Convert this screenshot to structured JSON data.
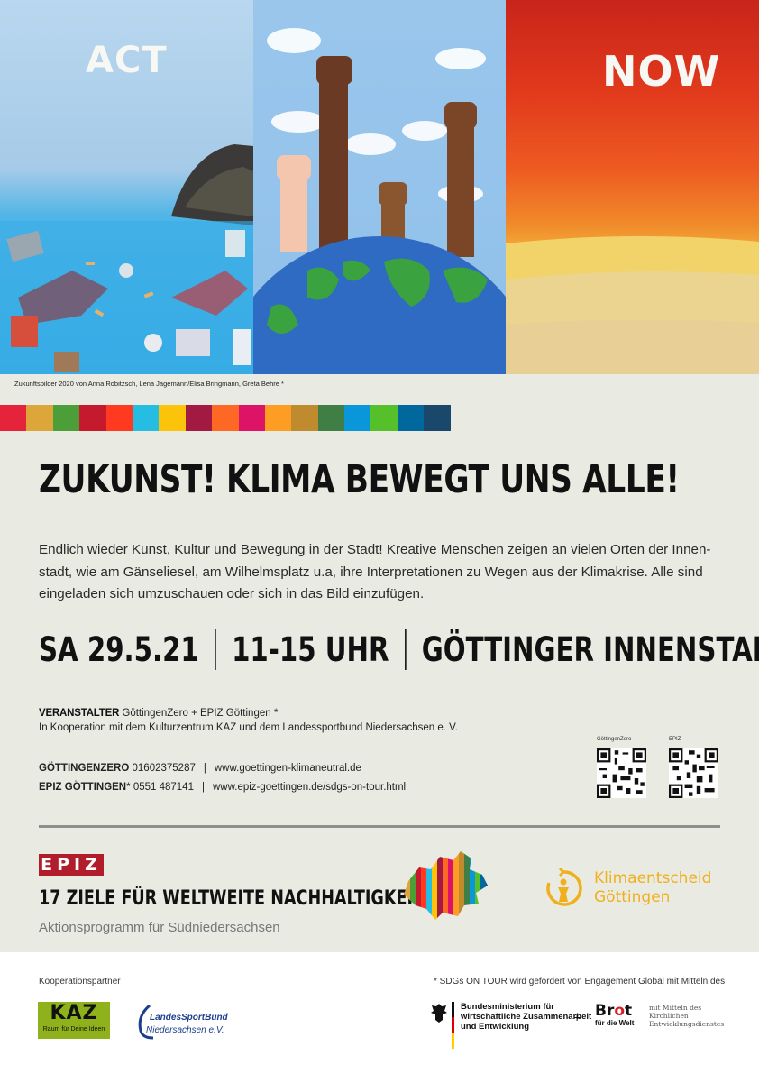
{
  "hero": {
    "word_left": "ACT",
    "word_right": "NOW",
    "caption": "Zukunftsbilder 2020 von Anna Robitzsch, Lena Jagemann/Elisa Bringmann, Greta Behre *"
  },
  "sdg_colors": [
    "#e5243b",
    "#dda63a",
    "#4c9f38",
    "#c5192d",
    "#ff3a21",
    "#26bde2",
    "#fcc30b",
    "#a21942",
    "#fd6925",
    "#dd1367",
    "#fd9d24",
    "#bf8b2e",
    "#3f7e44",
    "#0a97d9",
    "#56c02b",
    "#00689d",
    "#19486a"
  ],
  "title": "ZUKUNST! KLIMA BEWEGT UNS ALLE!",
  "intro": "Endlich wieder Kunst, Kultur und Bewegung in der Stadt! Kreative Menschen zeigen an vielen Orten der Innen-stadt, wie am Gänseliesel, am Wilhelmsplatz u.a, ihre Interpretationen zu Wegen aus der Klimakrise. Alle sind eingeladen sich umzuschauen oder sich in das Bild einzufügen.",
  "event": {
    "date": "SA 29.5.21",
    "time": "11-15 UHR",
    "place": "GÖTTINGER INNENSTADT"
  },
  "organizer": {
    "label": "VERANSTALTER",
    "value": "GöttingenZero + EPIZ Göttingen *",
    "cooperation": "In Kooperation mit dem Kulturzentrum KAZ und dem Landessportbund Niedersachsen e. V."
  },
  "contacts": [
    {
      "name": "GÖTTINGENZERO",
      "phone": "01602375287",
      "url": "www.goettingen-klimaneutral.de"
    },
    {
      "name": "EPIZ GÖTTINGEN",
      "name_suffix": "*",
      "phone": "0551 487141",
      "url": "www.epiz-goettingen.de/sdgs-on-tour.html"
    }
  ],
  "qr_codes": [
    {
      "label": "GöttingenZero"
    },
    {
      "label": "EPIZ"
    }
  ],
  "program": {
    "logo": "EPIZ",
    "title": "17 ZIELE FÜR WELTWEITE NACHHALTIGKEIT",
    "subtitle": "Aktionsprogramm für Südniedersachsen"
  },
  "klimaentscheid": {
    "line1": "Klimaentscheid",
    "line2": "Göttingen",
    "color": "#f0b01e"
  },
  "partners": {
    "label": "Kooperationspartner",
    "note": "* SDGs ON TOUR wird gefördert von Engagement Global mit Mitteln des",
    "kaz_big": "KAZ",
    "kaz_small": "Raum für Deine Ideen",
    "lsb_line1": "LandesSportBund",
    "lsb_line2": "Niedersachsen e.V.",
    "bmz_line1": "Bundesministerium für",
    "bmz_line2": "wirtschaftliche Zusammenarbeit",
    "bmz_line3": "und Entwicklung",
    "plus": "+",
    "brot_big_a": "Br",
    "brot_big_o": "o",
    "brot_big_b": "t",
    "brot_small": "für die Welt",
    "brot_desc1": "mit Mitteln des",
    "brot_desc2": "Kirchlichen",
    "brot_desc3": "Entwicklungsdienstes"
  }
}
